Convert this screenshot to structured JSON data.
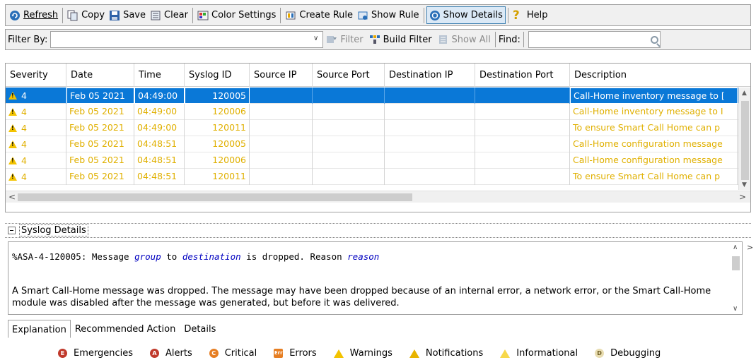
{
  "toolbar": {
    "refresh": "Refresh",
    "copy": "Copy",
    "save": "Save",
    "clear": "Clear",
    "color_settings": "Color Settings",
    "create_rule": "Create Rule",
    "show_rule": "Show Rule",
    "show_details": "Show Details",
    "help": "Help"
  },
  "filter_bar": {
    "filter_by_label": "Filter By:",
    "filter_value": "",
    "filter_button": "Filter",
    "build_filter_button": "Build Filter",
    "show_all_button": "Show All",
    "find_label": "Find:",
    "find_value": ""
  },
  "grid": {
    "columns": [
      "Severity",
      "Date",
      "Time",
      "Syslog ID",
      "Source IP",
      "Source Port",
      "Destination IP",
      "Destination Port",
      "Description"
    ],
    "rows": [
      {
        "severity": "4",
        "date": "Feb 05 2021",
        "time": "04:49:00",
        "syslog_id": "120005",
        "source_ip": "",
        "source_port": "",
        "dest_ip": "",
        "dest_port": "",
        "description": "Call-Home inventory message to [",
        "selected": true
      },
      {
        "severity": "4",
        "date": "Feb 05 2021",
        "time": "04:49:00",
        "syslog_id": "120006",
        "source_ip": "",
        "source_port": "",
        "dest_ip": "",
        "dest_port": "",
        "description": "Call-Home inventory message to I",
        "selected": false
      },
      {
        "severity": "4",
        "date": "Feb 05 2021",
        "time": "04:49:00",
        "syslog_id": "120011",
        "source_ip": "",
        "source_port": "",
        "dest_ip": "",
        "dest_port": "",
        "description": "To ensure Smart Call Home can p",
        "selected": false
      },
      {
        "severity": "4",
        "date": "Feb 05 2021",
        "time": "04:48:51",
        "syslog_id": "120005",
        "source_ip": "",
        "source_port": "",
        "dest_ip": "",
        "dest_port": "",
        "description": "Call-Home configuration message",
        "selected": false
      },
      {
        "severity": "4",
        "date": "Feb 05 2021",
        "time": "04:48:51",
        "syslog_id": "120006",
        "source_ip": "",
        "source_port": "",
        "dest_ip": "",
        "dest_port": "",
        "description": "Call-Home configuration message",
        "selected": false
      },
      {
        "severity": "4",
        "date": "Feb 05 2021",
        "time": "04:48:51",
        "syslog_id": "120011",
        "source_ip": "",
        "source_port": "",
        "dest_ip": "",
        "dest_port": "",
        "description": "To ensure Smart Call Home can p",
        "selected": false
      }
    ]
  },
  "details": {
    "title": "Syslog Details",
    "message_prefix": "%ASA-4-120005: Message ",
    "message_group": "group",
    "message_to": " to ",
    "message_destination": "destination",
    "message_middle": " is dropped. Reason ",
    "message_reason": "reason",
    "explanation": "A Smart Call-Home message was dropped. The message may have been dropped because of an internal error, a network error, or the Smart Call-Home module was disabled after the message was generated, but before it was delivered."
  },
  "tabs": [
    "Explanation",
    "Recommended Action",
    "Details"
  ],
  "legend": [
    {
      "label": "Emergencies",
      "color": "#c0392b",
      "glyph": "E"
    },
    {
      "label": "Alerts",
      "color": "#c0392b",
      "glyph": "A"
    },
    {
      "label": "Critical",
      "color": "#e67e22",
      "glyph": "C"
    },
    {
      "label": "Errors",
      "color": "#e67e22",
      "glyph": "Err"
    },
    {
      "label": "Warnings",
      "color": "#f3c300",
      "glyph": "!"
    },
    {
      "label": "Notifications",
      "color": "#f3c300",
      "glyph": "N"
    },
    {
      "label": "Informational",
      "color": "#f3c300",
      "glyph": "i"
    },
    {
      "label": "Debugging",
      "color": "#e8dcb0",
      "glyph": "D"
    }
  ],
  "colors": {
    "selection": "#0a78d7",
    "warning_text": "#e0b000"
  }
}
